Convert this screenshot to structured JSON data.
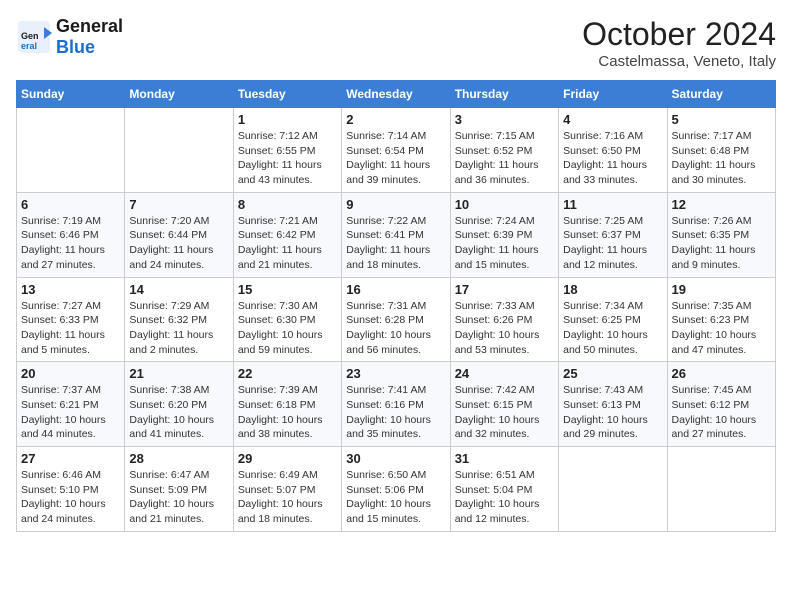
{
  "header": {
    "logo_general": "General",
    "logo_blue": "Blue",
    "month": "October 2024",
    "location": "Castelmassa, Veneto, Italy"
  },
  "weekdays": [
    "Sunday",
    "Monday",
    "Tuesday",
    "Wednesday",
    "Thursday",
    "Friday",
    "Saturday"
  ],
  "weeks": [
    [
      {
        "day": "",
        "info": ""
      },
      {
        "day": "",
        "info": ""
      },
      {
        "day": "1",
        "info": "Sunrise: 7:12 AM\nSunset: 6:55 PM\nDaylight: 11 hours and 43 minutes."
      },
      {
        "day": "2",
        "info": "Sunrise: 7:14 AM\nSunset: 6:54 PM\nDaylight: 11 hours and 39 minutes."
      },
      {
        "day": "3",
        "info": "Sunrise: 7:15 AM\nSunset: 6:52 PM\nDaylight: 11 hours and 36 minutes."
      },
      {
        "day": "4",
        "info": "Sunrise: 7:16 AM\nSunset: 6:50 PM\nDaylight: 11 hours and 33 minutes."
      },
      {
        "day": "5",
        "info": "Sunrise: 7:17 AM\nSunset: 6:48 PM\nDaylight: 11 hours and 30 minutes."
      }
    ],
    [
      {
        "day": "6",
        "info": "Sunrise: 7:19 AM\nSunset: 6:46 PM\nDaylight: 11 hours and 27 minutes."
      },
      {
        "day": "7",
        "info": "Sunrise: 7:20 AM\nSunset: 6:44 PM\nDaylight: 11 hours and 24 minutes."
      },
      {
        "day": "8",
        "info": "Sunrise: 7:21 AM\nSunset: 6:42 PM\nDaylight: 11 hours and 21 minutes."
      },
      {
        "day": "9",
        "info": "Sunrise: 7:22 AM\nSunset: 6:41 PM\nDaylight: 11 hours and 18 minutes."
      },
      {
        "day": "10",
        "info": "Sunrise: 7:24 AM\nSunset: 6:39 PM\nDaylight: 11 hours and 15 minutes."
      },
      {
        "day": "11",
        "info": "Sunrise: 7:25 AM\nSunset: 6:37 PM\nDaylight: 11 hours and 12 minutes."
      },
      {
        "day": "12",
        "info": "Sunrise: 7:26 AM\nSunset: 6:35 PM\nDaylight: 11 hours and 9 minutes."
      }
    ],
    [
      {
        "day": "13",
        "info": "Sunrise: 7:27 AM\nSunset: 6:33 PM\nDaylight: 11 hours and 5 minutes."
      },
      {
        "day": "14",
        "info": "Sunrise: 7:29 AM\nSunset: 6:32 PM\nDaylight: 11 hours and 2 minutes."
      },
      {
        "day": "15",
        "info": "Sunrise: 7:30 AM\nSunset: 6:30 PM\nDaylight: 10 hours and 59 minutes."
      },
      {
        "day": "16",
        "info": "Sunrise: 7:31 AM\nSunset: 6:28 PM\nDaylight: 10 hours and 56 minutes."
      },
      {
        "day": "17",
        "info": "Sunrise: 7:33 AM\nSunset: 6:26 PM\nDaylight: 10 hours and 53 minutes."
      },
      {
        "day": "18",
        "info": "Sunrise: 7:34 AM\nSunset: 6:25 PM\nDaylight: 10 hours and 50 minutes."
      },
      {
        "day": "19",
        "info": "Sunrise: 7:35 AM\nSunset: 6:23 PM\nDaylight: 10 hours and 47 minutes."
      }
    ],
    [
      {
        "day": "20",
        "info": "Sunrise: 7:37 AM\nSunset: 6:21 PM\nDaylight: 10 hours and 44 minutes."
      },
      {
        "day": "21",
        "info": "Sunrise: 7:38 AM\nSunset: 6:20 PM\nDaylight: 10 hours and 41 minutes."
      },
      {
        "day": "22",
        "info": "Sunrise: 7:39 AM\nSunset: 6:18 PM\nDaylight: 10 hours and 38 minutes."
      },
      {
        "day": "23",
        "info": "Sunrise: 7:41 AM\nSunset: 6:16 PM\nDaylight: 10 hours and 35 minutes."
      },
      {
        "day": "24",
        "info": "Sunrise: 7:42 AM\nSunset: 6:15 PM\nDaylight: 10 hours and 32 minutes."
      },
      {
        "day": "25",
        "info": "Sunrise: 7:43 AM\nSunset: 6:13 PM\nDaylight: 10 hours and 29 minutes."
      },
      {
        "day": "26",
        "info": "Sunrise: 7:45 AM\nSunset: 6:12 PM\nDaylight: 10 hours and 27 minutes."
      }
    ],
    [
      {
        "day": "27",
        "info": "Sunrise: 6:46 AM\nSunset: 5:10 PM\nDaylight: 10 hours and 24 minutes."
      },
      {
        "day": "28",
        "info": "Sunrise: 6:47 AM\nSunset: 5:09 PM\nDaylight: 10 hours and 21 minutes."
      },
      {
        "day": "29",
        "info": "Sunrise: 6:49 AM\nSunset: 5:07 PM\nDaylight: 10 hours and 18 minutes."
      },
      {
        "day": "30",
        "info": "Sunrise: 6:50 AM\nSunset: 5:06 PM\nDaylight: 10 hours and 15 minutes."
      },
      {
        "day": "31",
        "info": "Sunrise: 6:51 AM\nSunset: 5:04 PM\nDaylight: 10 hours and 12 minutes."
      },
      {
        "day": "",
        "info": ""
      },
      {
        "day": "",
        "info": ""
      }
    ]
  ]
}
